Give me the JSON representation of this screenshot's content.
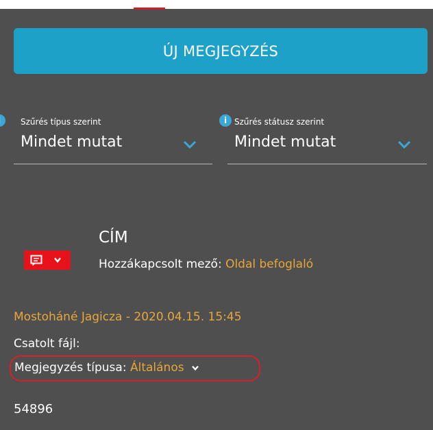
{
  "header": {
    "new_note_label": "ÚJ MEGJEGYZÉS"
  },
  "filters": {
    "type": {
      "caption": "Szűrés típus szerint",
      "value": "Mindet mutat",
      "icon": "info-icon"
    },
    "status": {
      "caption": "Szűrés státusz szerint",
      "value": "Mindet mutat",
      "icon": "info-icon"
    }
  },
  "note": {
    "title": "CÍM",
    "related_label": "Hozzákapcsolt mező:",
    "related_value": "Oldal befoglaló",
    "author_date": "Mostoháné Jagicza - 2020.04.15. 15:45",
    "attached_label": "Csatolt fájl:",
    "type_label": "Megjegyzés típusa:",
    "type_value": "Általános",
    "number": "54896"
  },
  "colors": {
    "panel_bg": "#4f4f4f",
    "button_bg": "#1ea1c9",
    "accent_orange": "#e7a73c",
    "badge_red": "#e8121a",
    "highlight_red": "#d7202a",
    "info_blue": "#3aa7d8"
  }
}
